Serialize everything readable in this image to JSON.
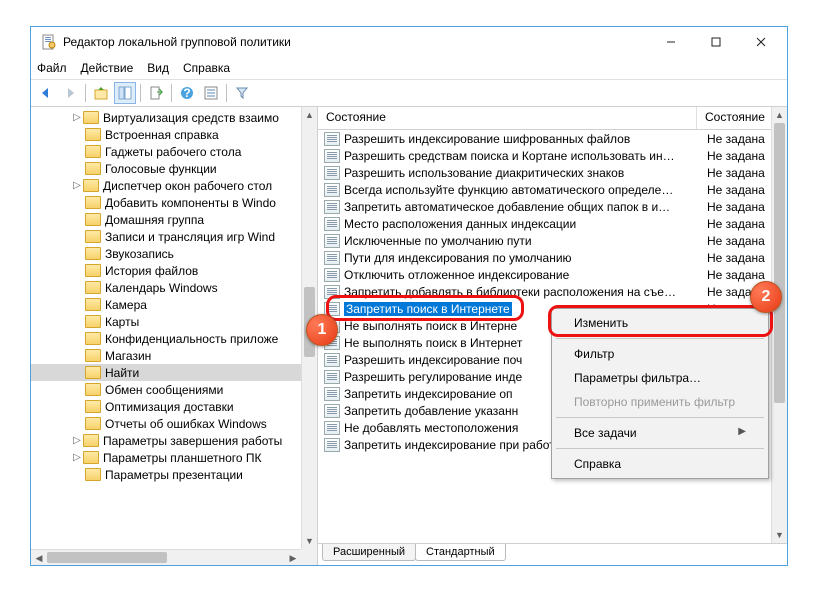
{
  "window": {
    "title": "Редактор локальной групповой политики"
  },
  "menu": {
    "file": "Файл",
    "action": "Действие",
    "view": "Вид",
    "help": "Справка"
  },
  "tree": {
    "items": [
      {
        "label": "Виртуализация средств взаимо",
        "expandable": true
      },
      {
        "label": "Встроенная справка"
      },
      {
        "label": "Гаджеты рабочего стола"
      },
      {
        "label": "Голосовые функции"
      },
      {
        "label": "Диспетчер окон рабочего стол",
        "expandable": true
      },
      {
        "label": "Добавить компоненты в Windo"
      },
      {
        "label": "Домашняя группа"
      },
      {
        "label": "Записи и трансляция игр Wind"
      },
      {
        "label": "Звукозапись"
      },
      {
        "label": "История файлов"
      },
      {
        "label": "Календарь Windows"
      },
      {
        "label": "Камера"
      },
      {
        "label": "Карты"
      },
      {
        "label": "Конфиденциальность приложе"
      },
      {
        "label": "Магазин"
      },
      {
        "label": "Найти",
        "selected": true
      },
      {
        "label": "Обмен сообщениями"
      },
      {
        "label": "Оптимизация доставки"
      },
      {
        "label": "Отчеты об ошибках Windows"
      },
      {
        "label": "Параметры завершения работы",
        "expandable": true
      },
      {
        "label": "Параметры планшетного ПК",
        "expandable": true
      },
      {
        "label": "Параметры презентации"
      }
    ]
  },
  "list": {
    "col_name": "Состояние",
    "col_state": "Состояние",
    "state_default": "Не задана",
    "rows": [
      "Разрешить индексирование шифрованных файлов",
      "Разрешить средствам поиска и Кортане использовать ин…",
      "Разрешить использование диакритических знаков",
      "Всегда используйте функцию автоматического определе…",
      "Запретить автоматическое добавление общих папок в и…",
      "Место расположения данных индексации",
      "Исключенные по умолчанию пути",
      "Пути для индексирования по умолчанию",
      "Отключить отложенное индексирование",
      "Запретить добавлять в библиотеки расположения на съе…",
      "Запретить поиск в Интернете",
      "Не выполнять поиск в Интерне",
      "Не выполнять поиск в Интернет",
      "Разрешить индексирование поч",
      "Разрешить регулирование инде",
      "Запретить индексирование оп",
      "Запретить добавление указанн",
      "Не добавлять местоположения",
      "Запретить индексирование при работе от батареи для эк…"
    ],
    "selected_index": 10
  },
  "tabs": {
    "ext": "Расширенный",
    "std": "Стандартный"
  },
  "context_menu": {
    "edit": "Изменить",
    "filter": "Фильтр",
    "filter_params": "Параметры фильтра…",
    "reapply": "Повторно применить фильтр",
    "all_tasks": "Все задачи",
    "help": "Справка"
  }
}
